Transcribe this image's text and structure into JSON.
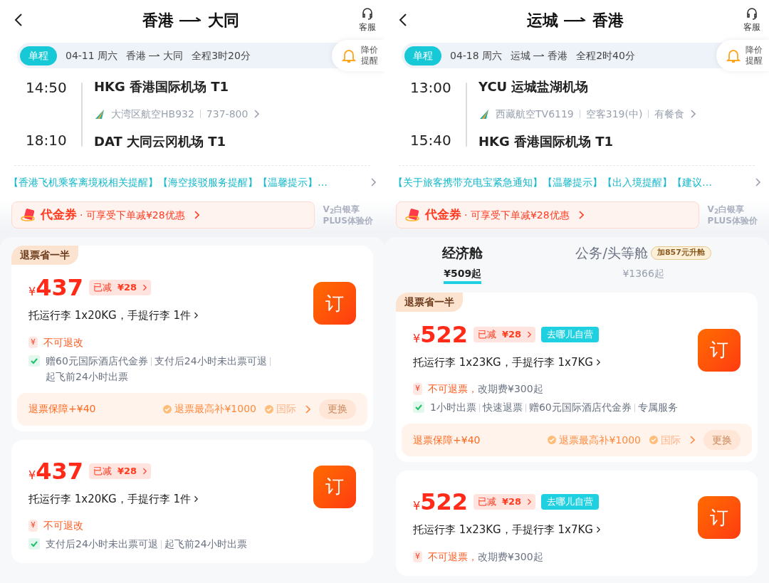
{
  "screens": [
    {
      "title": {
        "from": "香港",
        "to": "大同"
      },
      "service": "客服",
      "trip": {
        "type": "单程",
        "date": "04-11 周六",
        "from": "香港",
        "to": "大同",
        "duration": "全程3时20分"
      },
      "price_alert": [
        "降价",
        "提醒"
      ],
      "segment": {
        "dep_time": "14:50",
        "dep_airport": "HKG 香港国际机场 T1",
        "flight": [
          "大湾区航空HB932",
          "737-800"
        ],
        "arr_time": "18:10",
        "arr_airport": "DAT 大同云冈机场 T1"
      },
      "notice": "【香港飞机乘客离境税相关提醒】【海空接驳服务提醒】【温馨提示】…",
      "voucher": {
        "label": "代金券",
        "text": "· 可享受下单减¥28优惠"
      },
      "plus": [
        "V$_{2}$白银享",
        "PLUS体验价"
      ],
      "fares": [
        {
          "tag": "退票省一半",
          "currency": "¥",
          "price": "437",
          "discount": {
            "label": "已减",
            "amount": "¥28"
          },
          "baggage": "托运行李 1x20KG，手提行李 1件",
          "refund_icon": "¥",
          "refund": "不可退改",
          "perks": [
            "赠60元国际酒店代金券",
            "支付后24小时未出票可退",
            "起飞前24小时出票"
          ],
          "insurance": {
            "title": "退票保障+¥40",
            "items": [
              "退票最高补¥1000",
              "国际"
            ],
            "button": "更换"
          },
          "book": "订"
        },
        {
          "currency": "¥",
          "price": "437",
          "discount": {
            "label": "已减",
            "amount": "¥28"
          },
          "baggage": "托运行李 1x20KG，手提行李 1件",
          "refund_icon": "¥",
          "refund": "不可退改",
          "perks": [
            "支付后24小时未出票可退",
            "起飞前24小时出票"
          ],
          "book": "订"
        }
      ]
    },
    {
      "title": {
        "from": "运城",
        "to": "香港"
      },
      "service": "客服",
      "trip": {
        "type": "单程",
        "date": "04-18 周六",
        "from": "运城",
        "to": "香港",
        "duration": "全程2时40分"
      },
      "price_alert": [
        "降价",
        "提醒"
      ],
      "segment": {
        "dep_time": "13:00",
        "dep_airport": "YCU 运城盐湖机场",
        "flight": [
          "西藏航空TV6119",
          "空客319(中)",
          "有餐食"
        ],
        "arr_time": "15:40",
        "arr_airport": "HKG 香港国际机场 T1"
      },
      "notice": "【关于旅客携带充电宝紧急通知】【温馨提示】【出入境提醒】【建议…",
      "voucher": {
        "label": "代金券",
        "text": "· 可享受下单减¥28优惠"
      },
      "plus": [
        "V$_{2}$白银享",
        "PLUS体验价"
      ],
      "cabin_tabs": [
        {
          "label": "经济舱",
          "price": "¥509起",
          "selected": true
        },
        {
          "label": "公务/头等舱",
          "price": "¥1366起",
          "selected": false,
          "badge": "加857元升舱"
        }
      ],
      "fares": [
        {
          "tag": "退票省一半",
          "currency": "¥",
          "price": "522",
          "discount": {
            "label": "已减",
            "amount": "¥28"
          },
          "badge": "去哪儿自营",
          "baggage": "托运行李 1x23KG，手提行李 1x7KG",
          "refund_icon": "¥",
          "refund": "不可退票，",
          "refund_note": "改期费¥300起",
          "perks": [
            "1小时出票",
            "快速退票",
            "赠60元国际酒店代金券",
            "专属服务"
          ],
          "insurance": {
            "title": "退票保障+¥40",
            "items": [
              "退票最高补¥1000",
              "国际"
            ],
            "button": "更换"
          },
          "book": "订"
        },
        {
          "currency": "¥",
          "price": "522",
          "discount": {
            "label": "已减",
            "amount": "¥28"
          },
          "badge": "去哪儿自营",
          "baggage": "托运行李 1x23KG，手提行李 1x7KG",
          "refund_icon": "¥",
          "refund": "不可退票，",
          "refund_note": "改期费¥300起",
          "book": "订"
        }
      ]
    }
  ]
}
